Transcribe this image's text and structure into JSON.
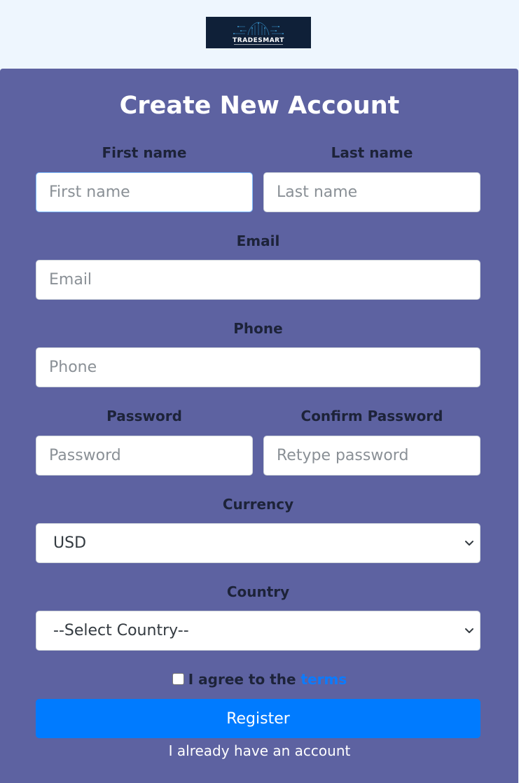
{
  "header": {
    "logo_text": "TRADESMART",
    "logo_bg": "#0f2038"
  },
  "form": {
    "title": "Create New Account",
    "first_name": {
      "label": "First name",
      "placeholder": "First name",
      "value": ""
    },
    "last_name": {
      "label": "Last name",
      "placeholder": "Last name",
      "value": ""
    },
    "email": {
      "label": "Email",
      "placeholder": "Email",
      "value": ""
    },
    "phone": {
      "label": "Phone",
      "placeholder": "Phone",
      "value": ""
    },
    "password": {
      "label": "Password",
      "placeholder": "Password",
      "value": ""
    },
    "confirm_password": {
      "label": "Confirm Password",
      "placeholder": "Retype password",
      "value": ""
    },
    "currency": {
      "label": "Currency",
      "selected": "USD"
    },
    "country": {
      "label": "Country",
      "selected": "--Select Country--"
    },
    "agree": {
      "prefix": "I agree to the",
      "terms_link": "terms",
      "checked": false
    },
    "register_label": "Register",
    "login_link": "I already have an account"
  },
  "colors": {
    "page_bg": "#eef6fe",
    "card_bg": "#5d62a1",
    "accent": "#007bff",
    "label_text": "#1d2339",
    "link": "#0b7bff"
  }
}
